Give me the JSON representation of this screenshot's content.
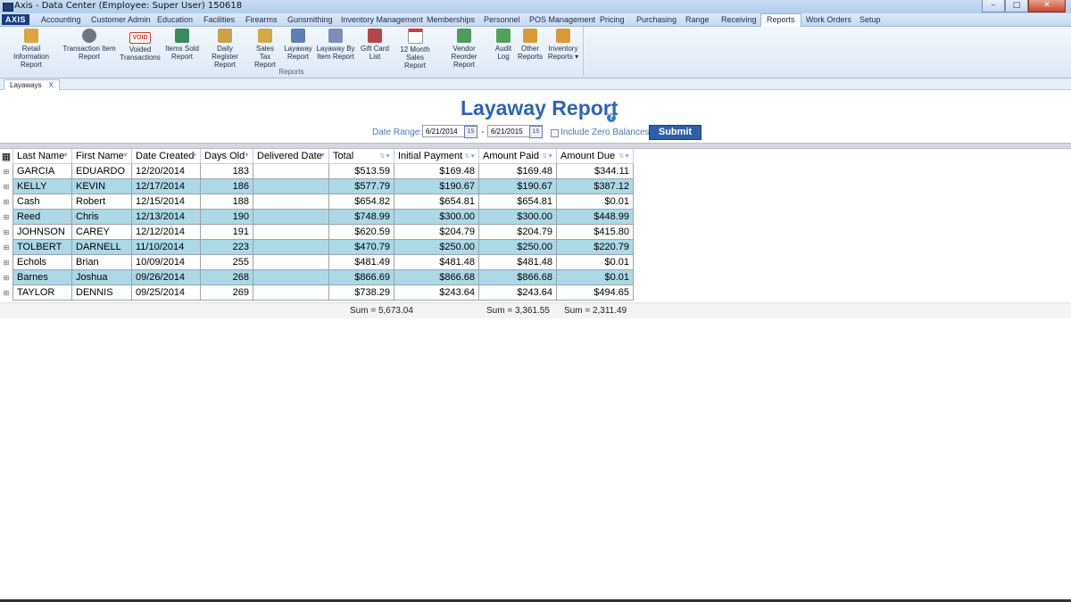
{
  "window": {
    "title": "Axis - Data Center  (Employee: Super User) 150618",
    "controls": {
      "minimize": "–",
      "maximize": "□",
      "close": "✕"
    }
  },
  "menu": {
    "logo": "AXIS",
    "tabs": [
      "Accounting",
      "Customer Admin",
      "Education",
      "Facilities",
      "Firearms",
      "Gunsmithing",
      "Inventory Management",
      "Memberships",
      "Personnel",
      "POS Management",
      "Pricing",
      "Purchasing",
      "Range",
      "Receiving",
      "Reports",
      "Work Orders",
      "Setup"
    ],
    "active": "Reports"
  },
  "ribbon": {
    "group_label": "Reports",
    "buttons": [
      {
        "l1": "Retail Information",
        "l2": "Report",
        "icon": "retail-report-icon",
        "color": "#d9a640"
      },
      {
        "l1": "Transaction Item",
        "l2": "Report",
        "icon": "transaction-item-icon",
        "color": "#6f7680"
      },
      {
        "l1": "Voided",
        "l2": "Transactions",
        "icon": "void-stamp-icon",
        "color": "#d23a2a"
      },
      {
        "l1": "Items Sold",
        "l2": "Report",
        "icon": "items-sold-icon",
        "color": "#3d8a5a"
      },
      {
        "l1": "Daily Register",
        "l2": "Report",
        "icon": "daily-register-icon",
        "color": "#c9a24a"
      },
      {
        "l1": "Sales Tax",
        "l2": "Report",
        "icon": "sales-tax-icon",
        "color": "#d4a848"
      },
      {
        "l1": "Layaway",
        "l2": "Report",
        "icon": "layaway-report-icon",
        "color": "#5c7fb8"
      },
      {
        "l1": "Layaway By",
        "l2": "Item Report",
        "icon": "layaway-item-icon",
        "color": "#7c8fb4"
      },
      {
        "l1": "Gift Card",
        "l2": "List",
        "icon": "gift-card-icon",
        "color": "#b2484a"
      },
      {
        "l1": "12 Month",
        "l2": "Sales Report",
        "icon": "calendar-icon",
        "color": "#cf3b3b"
      },
      {
        "l1": "Vendor Reorder",
        "l2": "Report",
        "icon": "vendor-reorder-icon",
        "color": "#4f9a5c"
      },
      {
        "l1": "Audit",
        "l2": "Log",
        "icon": "audit-log-icon",
        "color": "#52a35a"
      },
      {
        "l1": "Other",
        "l2": "Reports",
        "icon": "other-reports-icon",
        "color": "#d99b38"
      },
      {
        "l1": "Inventory",
        "l2": "Reports ▾",
        "icon": "inventory-reports-icon",
        "color": "#d99b38"
      }
    ]
  },
  "doc_tab": {
    "label": "Layaways",
    "close": "X"
  },
  "report": {
    "title": "Layaway Report",
    "help": "?",
    "date_range_label": "Date Range:",
    "start_date": "6/21/2014",
    "end_date": "6/21/2015",
    "dash": "-",
    "cal_label": "15",
    "include_zero_label": "Include Zero Balances",
    "submit_label": "Submit"
  },
  "grid": {
    "columns": [
      "Last Name",
      "First Name",
      "Date Created",
      "Days Old",
      "Delivered Date",
      "Total",
      "Initial Payment",
      "Amount Paid",
      "Amount Due"
    ],
    "rows": [
      [
        "GARCIA",
        "EDUARDO",
        "12/20/2014",
        "183",
        "",
        "$513.59",
        "$169.48",
        "$169.48",
        "$344.11"
      ],
      [
        "KELLY",
        "KEVIN",
        "12/17/2014",
        "186",
        "",
        "$577.79",
        "$190.67",
        "$190.67",
        "$387.12"
      ],
      [
        "Cash",
        "Robert",
        "12/15/2014",
        "188",
        "",
        "$654.82",
        "$654.81",
        "$654.81",
        "$0.01"
      ],
      [
        "Reed",
        "Chris",
        "12/13/2014",
        "190",
        "",
        "$748.99",
        "$300.00",
        "$300.00",
        "$448.99"
      ],
      [
        "JOHNSON",
        "CAREY",
        "12/12/2014",
        "191",
        "",
        "$620.59",
        "$204.79",
        "$204.79",
        "$415.80"
      ],
      [
        "TOLBERT",
        "DARNELL",
        "11/10/2014",
        "223",
        "",
        "$470.79",
        "$250.00",
        "$250.00",
        "$220.79"
      ],
      [
        "Echols",
        "Brian",
        "10/09/2014",
        "255",
        "",
        "$481.49",
        "$481.48",
        "$481.48",
        "$0.01"
      ],
      [
        "Barnes",
        "Joshua",
        "09/26/2014",
        "268",
        "",
        "$866.69",
        "$866.68",
        "$866.68",
        "$0.01"
      ],
      [
        "TAYLOR",
        "DENNIS",
        "09/25/2014",
        "269",
        "",
        "$738.29",
        "$243.64",
        "$243.64",
        "$494.65"
      ]
    ],
    "sums": {
      "total": "Sum = 5,673.04",
      "amount_paid": "Sum = 3,361.55",
      "amount_due": "Sum = 2,311.49"
    }
  }
}
